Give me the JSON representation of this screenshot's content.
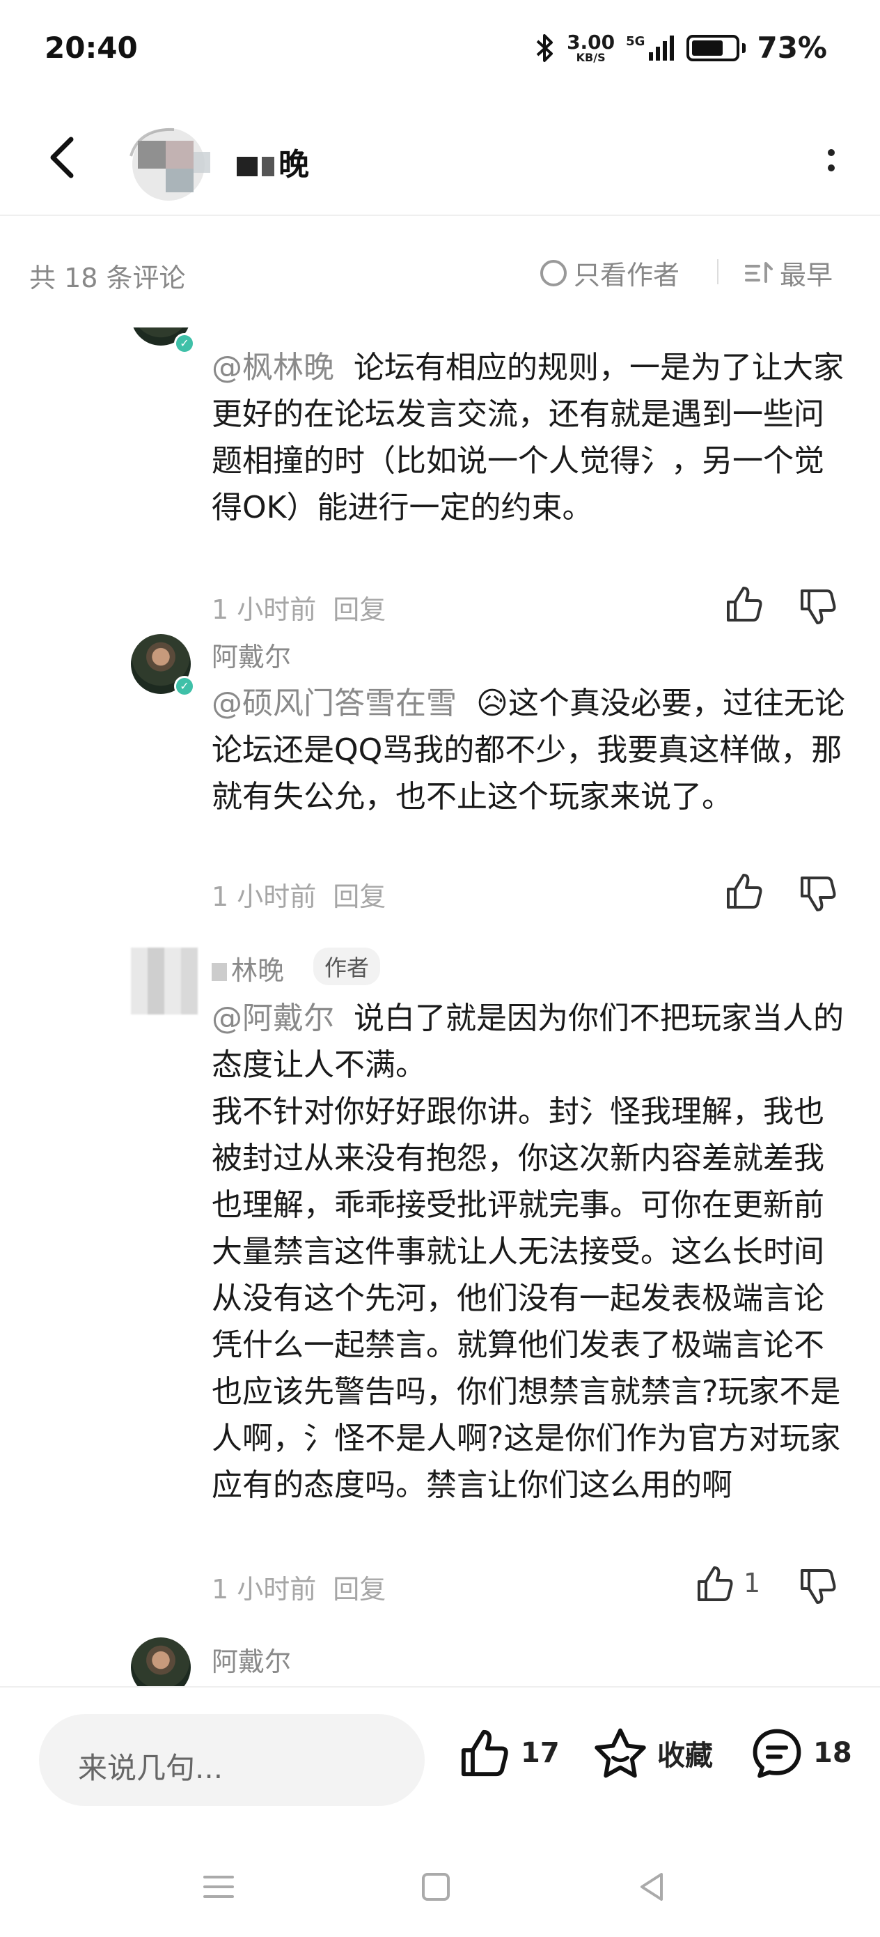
{
  "status_bar": {
    "time": "20:40",
    "net_speed": "3.00",
    "net_unit": "KB/S",
    "signal": "5G",
    "battery_percent": "73%",
    "battery_level": 0.73
  },
  "header": {
    "user_name_visible": "晚"
  },
  "comments_bar": {
    "count_label": "共 18 条评论",
    "only_author_label": "只看作者",
    "sort_label": "最早"
  },
  "comments": [
    {
      "mention": "@枫林晚",
      "text": "论坛有相应的规则，一是为了让大家更好的在论坛发言交流，还有就是遇到一些问题相撞的时（比如说一个人觉得氵，另一个觉得OK）能进行一定的约束。",
      "time": "1 小时前",
      "reply": "回复"
    },
    {
      "name": "阿戴尔",
      "mention": "@硕风门答雪在雪",
      "emoji": "😥",
      "text": "这个真没必要，过往无论论坛还是QQ骂我的都不少，我要真这样做，那就有失公允，也不止这个玩家来说了。",
      "time": "1 小时前",
      "reply": "回复"
    },
    {
      "name": "林晚",
      "author_tag": "作者",
      "mention": "@阿戴尔",
      "text": "说白了就是因为你们不把玩家当人的态度让人不满。\n我不针对你好好跟你讲。封氵怪我理解，我也被封过从来没有抱怨，你这次新内容差就差我也理解，乖乖接受批评就完事。可你在更新前大量禁言这件事就让人无法接受。这么长时间从没有这个先河，他们没有一起发表极端言论凭什么一起禁言。就算他们发表了极端言论不也应该先警告吗，你们想禁言就禁言?玩家不是人啊，氵怪不是人啊?这是你们作为官方对玩家应有的态度吗。禁言让你们这么用的啊",
      "time": "1 小时前",
      "reply": "回复",
      "likes": "1"
    },
    {
      "name": "阿戴尔"
    }
  ],
  "bottom_bar": {
    "input_placeholder": "来说几句...",
    "like_count": "17",
    "fav_label": "收藏",
    "comment_count": "18"
  }
}
